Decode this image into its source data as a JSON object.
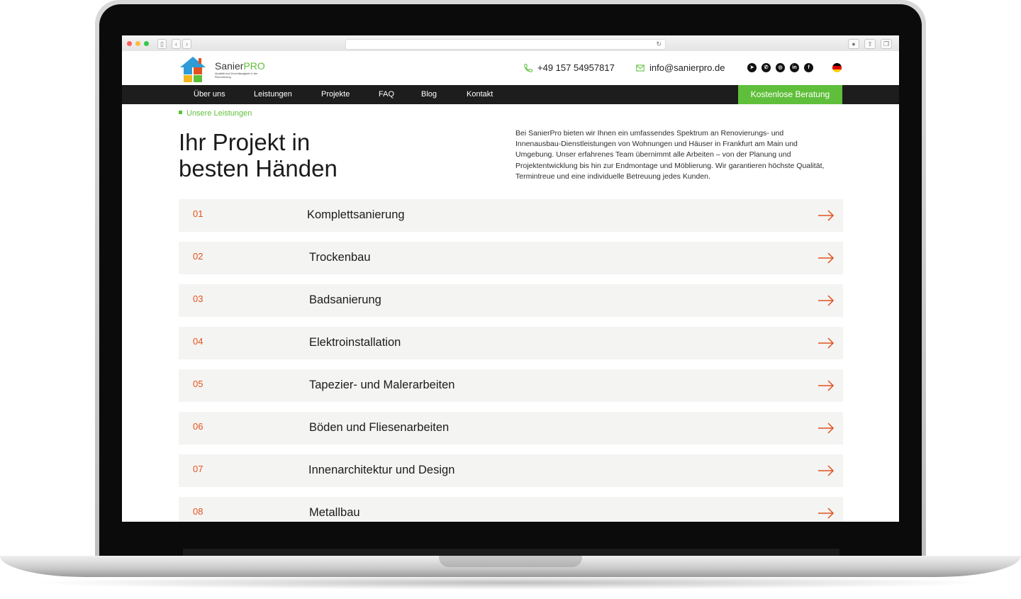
{
  "site": {
    "logo": {
      "name_a": "Sanier",
      "name_b": "PRO",
      "tagline": "Qualität und Zuverlässigkeit in der Renovierung"
    },
    "phone": "+49 157 54957817",
    "email": "info@sanierpro.de",
    "social": [
      {
        "icon": "telegram-icon",
        "glyph": "➤"
      },
      {
        "icon": "whatsapp-icon",
        "glyph": "✆"
      },
      {
        "icon": "instagram-icon",
        "glyph": "◎"
      },
      {
        "icon": "linkedin-icon",
        "glyph": "in"
      },
      {
        "icon": "facebook-icon",
        "glyph": "f"
      }
    ],
    "language_icon": "german-flag-icon"
  },
  "nav": {
    "items": [
      "Über uns",
      "Leistungen",
      "Projekte",
      "FAQ",
      "Blog",
      "Kontakt"
    ],
    "cta": "Kostenlose Beratung"
  },
  "page": {
    "breadcrumb": "Unsere Leistungen",
    "headline_line1": "Ihr Projekt in",
    "headline_line2": "besten Händen",
    "intro": "Bei SanierPro bieten wir Ihnen ein umfassendes Spektrum an Renovierungs- und Innenausbau-Dienstleistungen von Wohnungen und Häuser in Frankfurt am Main und Umgebung. Unser erfahrenes Team übernimmt alle Arbeiten – von der Planung und Projektentwicklung bis hin zur Endmontage und Möblierung. Wir garantieren höchste Qualität, Termintreue und eine individuelle Betreuung jedes Kunden."
  },
  "services": [
    {
      "num": "01",
      "title": "Komplettsanierung"
    },
    {
      "num": "02",
      "title": "Trockenbau"
    },
    {
      "num": "03",
      "title": "Badsanierung"
    },
    {
      "num": "04",
      "title": "Elektroinstallation"
    },
    {
      "num": "05",
      "title": "Tapezier- und Malerarbeiten"
    },
    {
      "num": "06",
      "title": "Böden und Fliesenarbeiten"
    },
    {
      "num": "07",
      "title": "Innenarchitektur und Design"
    },
    {
      "num": "08",
      "title": "Metallbau"
    }
  ],
  "colors": {
    "brand_green": "#5fbf3a",
    "accent_orange": "#e2521f",
    "nav_dark": "#1d1d1d"
  }
}
